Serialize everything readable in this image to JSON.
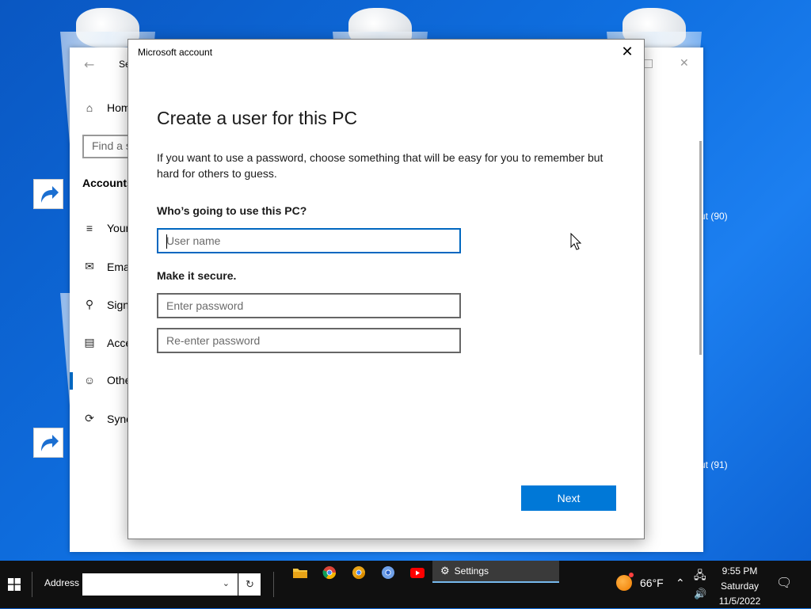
{
  "desktop": {
    "bin_labels": [
      "ut (90)",
      "ut (91)"
    ]
  },
  "settings_window": {
    "title": "Se",
    "search_placeholder": "Find a s",
    "section_heading": "Accounts",
    "nav_items": [
      {
        "icon": "home-icon",
        "label": "Hom"
      },
      {
        "icon": "user-info-icon",
        "label": "Your"
      },
      {
        "icon": "mail-icon",
        "label": "Ema"
      },
      {
        "icon": "key-icon",
        "label": "Sign"
      },
      {
        "icon": "briefcase-icon",
        "label": "Acce"
      },
      {
        "icon": "add-user-icon",
        "label": "Othe"
      },
      {
        "icon": "sync-icon",
        "label": "Sync"
      }
    ]
  },
  "dialog": {
    "title": "Microsoft account",
    "heading": "Create a user for this PC",
    "description": "If you want to use a password, choose something that will be easy for you to remember but hard for others to guess.",
    "who_label": "Who’s going to use this PC?",
    "username_placeholder": "User name",
    "secure_label": "Make it secure.",
    "password_placeholder": "Enter password",
    "reenter_placeholder": "Re-enter password",
    "next_label": "Next"
  },
  "taskbar": {
    "address_label": "Address",
    "address_value": "",
    "active_app_label": "Settings",
    "weather": "66°F",
    "time": "9:55 PM",
    "day": "Saturday",
    "date": "11/5/2022"
  },
  "colors": {
    "accent": "#0078d7",
    "focus": "#0067c0",
    "taskbar": "#101010"
  }
}
